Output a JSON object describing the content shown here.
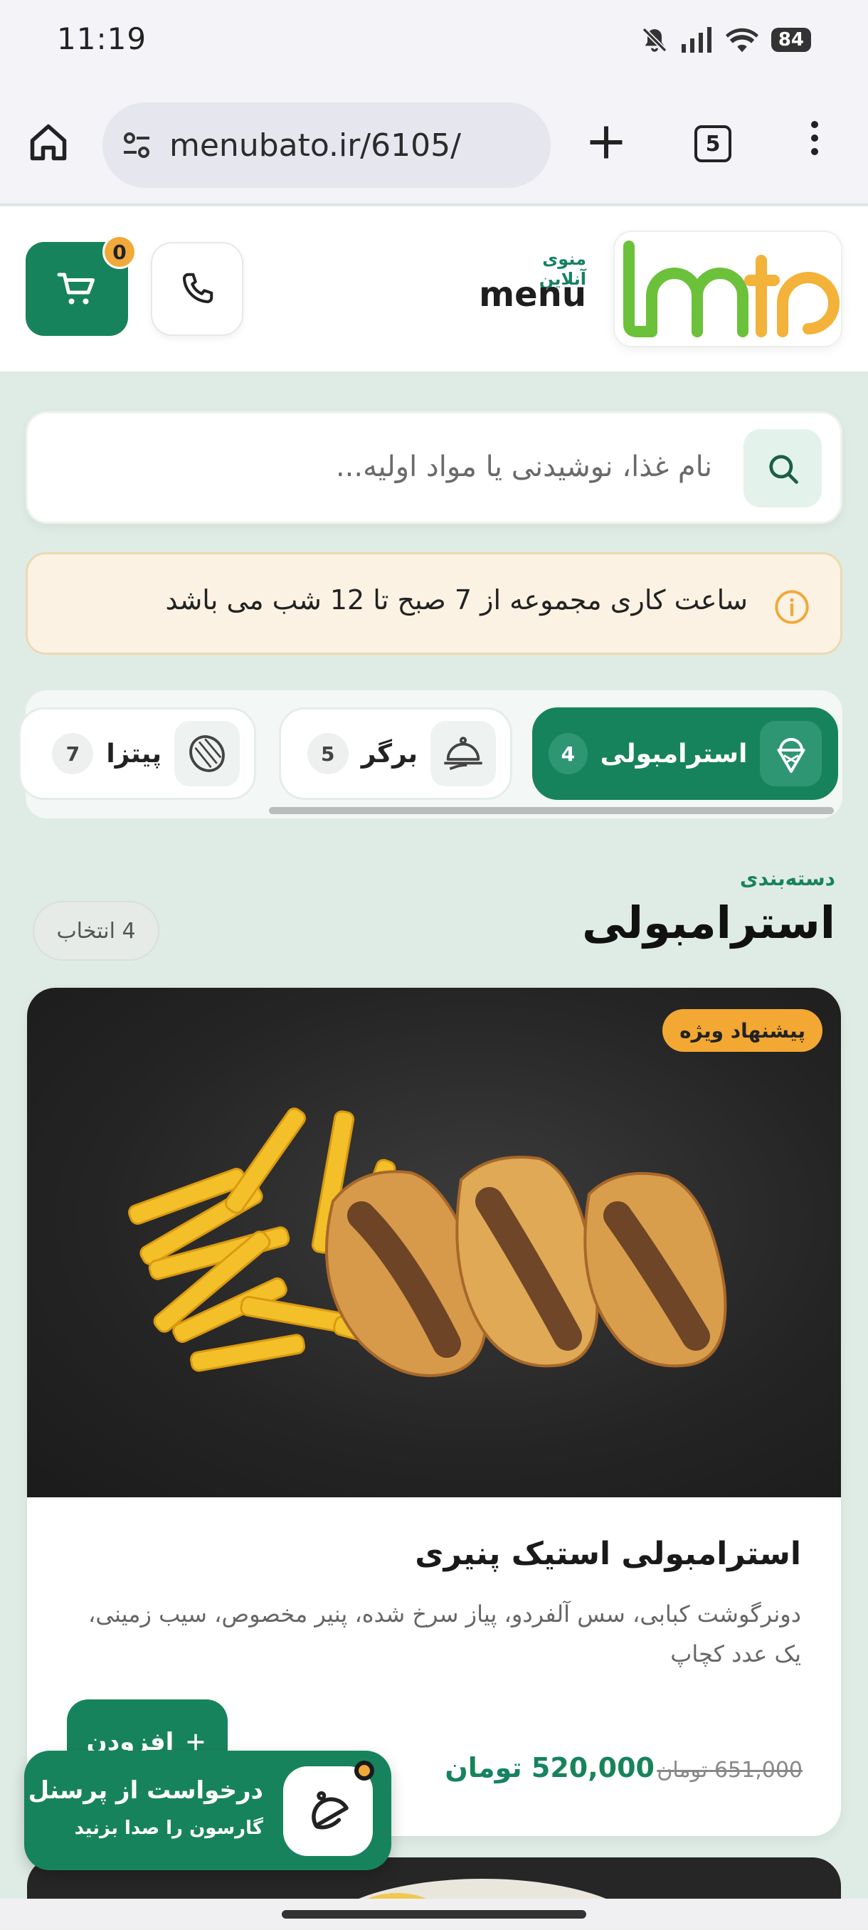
{
  "status_bar": {
    "time": "11:19",
    "battery": "84",
    "icons": [
      "bell-off-icon",
      "signal-icon",
      "wifi-icon",
      "battery-icon"
    ]
  },
  "browser": {
    "url": "menubato.ir/6105/",
    "tab_count": "5"
  },
  "header": {
    "cart_count": "0",
    "brand_subtitle": "منوی آنلاین",
    "brand_title": "menu",
    "accent": "#17835c"
  },
  "search": {
    "placeholder": "نام غذا، نوشیدنی یا مواد اولیه..."
  },
  "info_banner": {
    "text": "ساعت کاری مجموعه از 7 صبح تا 12 شب می باشد"
  },
  "categories": [
    {
      "label": "استرامبولی",
      "count": "4",
      "active": true
    },
    {
      "label": "برگر",
      "count": "5",
      "active": false
    },
    {
      "label": "پیتزا",
      "count": "7",
      "active": false
    }
  ],
  "section": {
    "small_label": "دسته‌بندی",
    "title": "استرامبولی",
    "count_label": "4 انتخاب"
  },
  "product": {
    "badge": "پیشنهاد ویژه",
    "name": "استرامبولی استیک پنیری",
    "description": "دونرگوشت کبابی، سس آلفردو، پیاز سرخ شده، پنیر مخصوص، سیب زمینی، یک عدد کچاپ",
    "price": "520,000 تومان",
    "old_price": "651,000 تومان",
    "add_label": "افزودن"
  },
  "staff_request": {
    "title": "درخواست از پرسنل",
    "subtitle": "گارسون را صدا بزنید"
  }
}
